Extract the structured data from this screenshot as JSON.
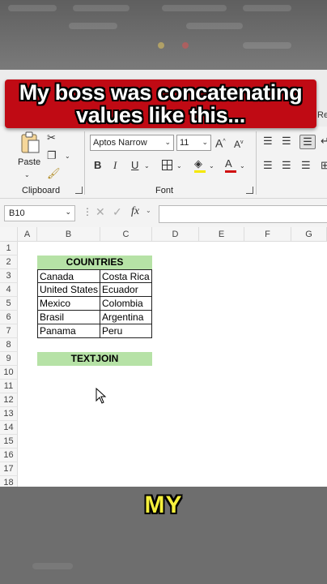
{
  "banner": {
    "line1": "My boss was concatenating",
    "line2": "values like this..."
  },
  "ribbon": {
    "tab_partial": "Re",
    "paste_label": "Paste",
    "clipboard_label": "Clipboard",
    "font_label": "Font",
    "font_name": "Aptos Narrow",
    "font_size": "11",
    "increase_font": "A",
    "decrease_font": "A",
    "bold": "B",
    "italic": "I",
    "underline": "U",
    "font_color_letter": "A"
  },
  "formula_bar": {
    "name_box": "B10",
    "fx": "fx",
    "value": ""
  },
  "columns": [
    "A",
    "B",
    "C",
    "D",
    "E",
    "F",
    "G"
  ],
  "rows": [
    "1",
    "2",
    "3",
    "4",
    "5",
    "6",
    "7",
    "8",
    "9",
    "10",
    "11",
    "12",
    "13",
    "14",
    "15",
    "16",
    "17",
    "18"
  ],
  "table": {
    "header": "COUNTRIES",
    "rows": [
      [
        "Canada",
        "Costa Rica"
      ],
      [
        "United States",
        "Ecuador"
      ],
      [
        "Mexico",
        "Colombia"
      ],
      [
        "Brasil",
        "Argentina"
      ],
      [
        "Panama",
        "Peru"
      ]
    ],
    "textjoin": "TEXTJOIN"
  },
  "caption": "MY",
  "colors": {
    "banner": "#c00a14",
    "header_fill": "#b6e2a6",
    "caption": "#f5f03c"
  }
}
